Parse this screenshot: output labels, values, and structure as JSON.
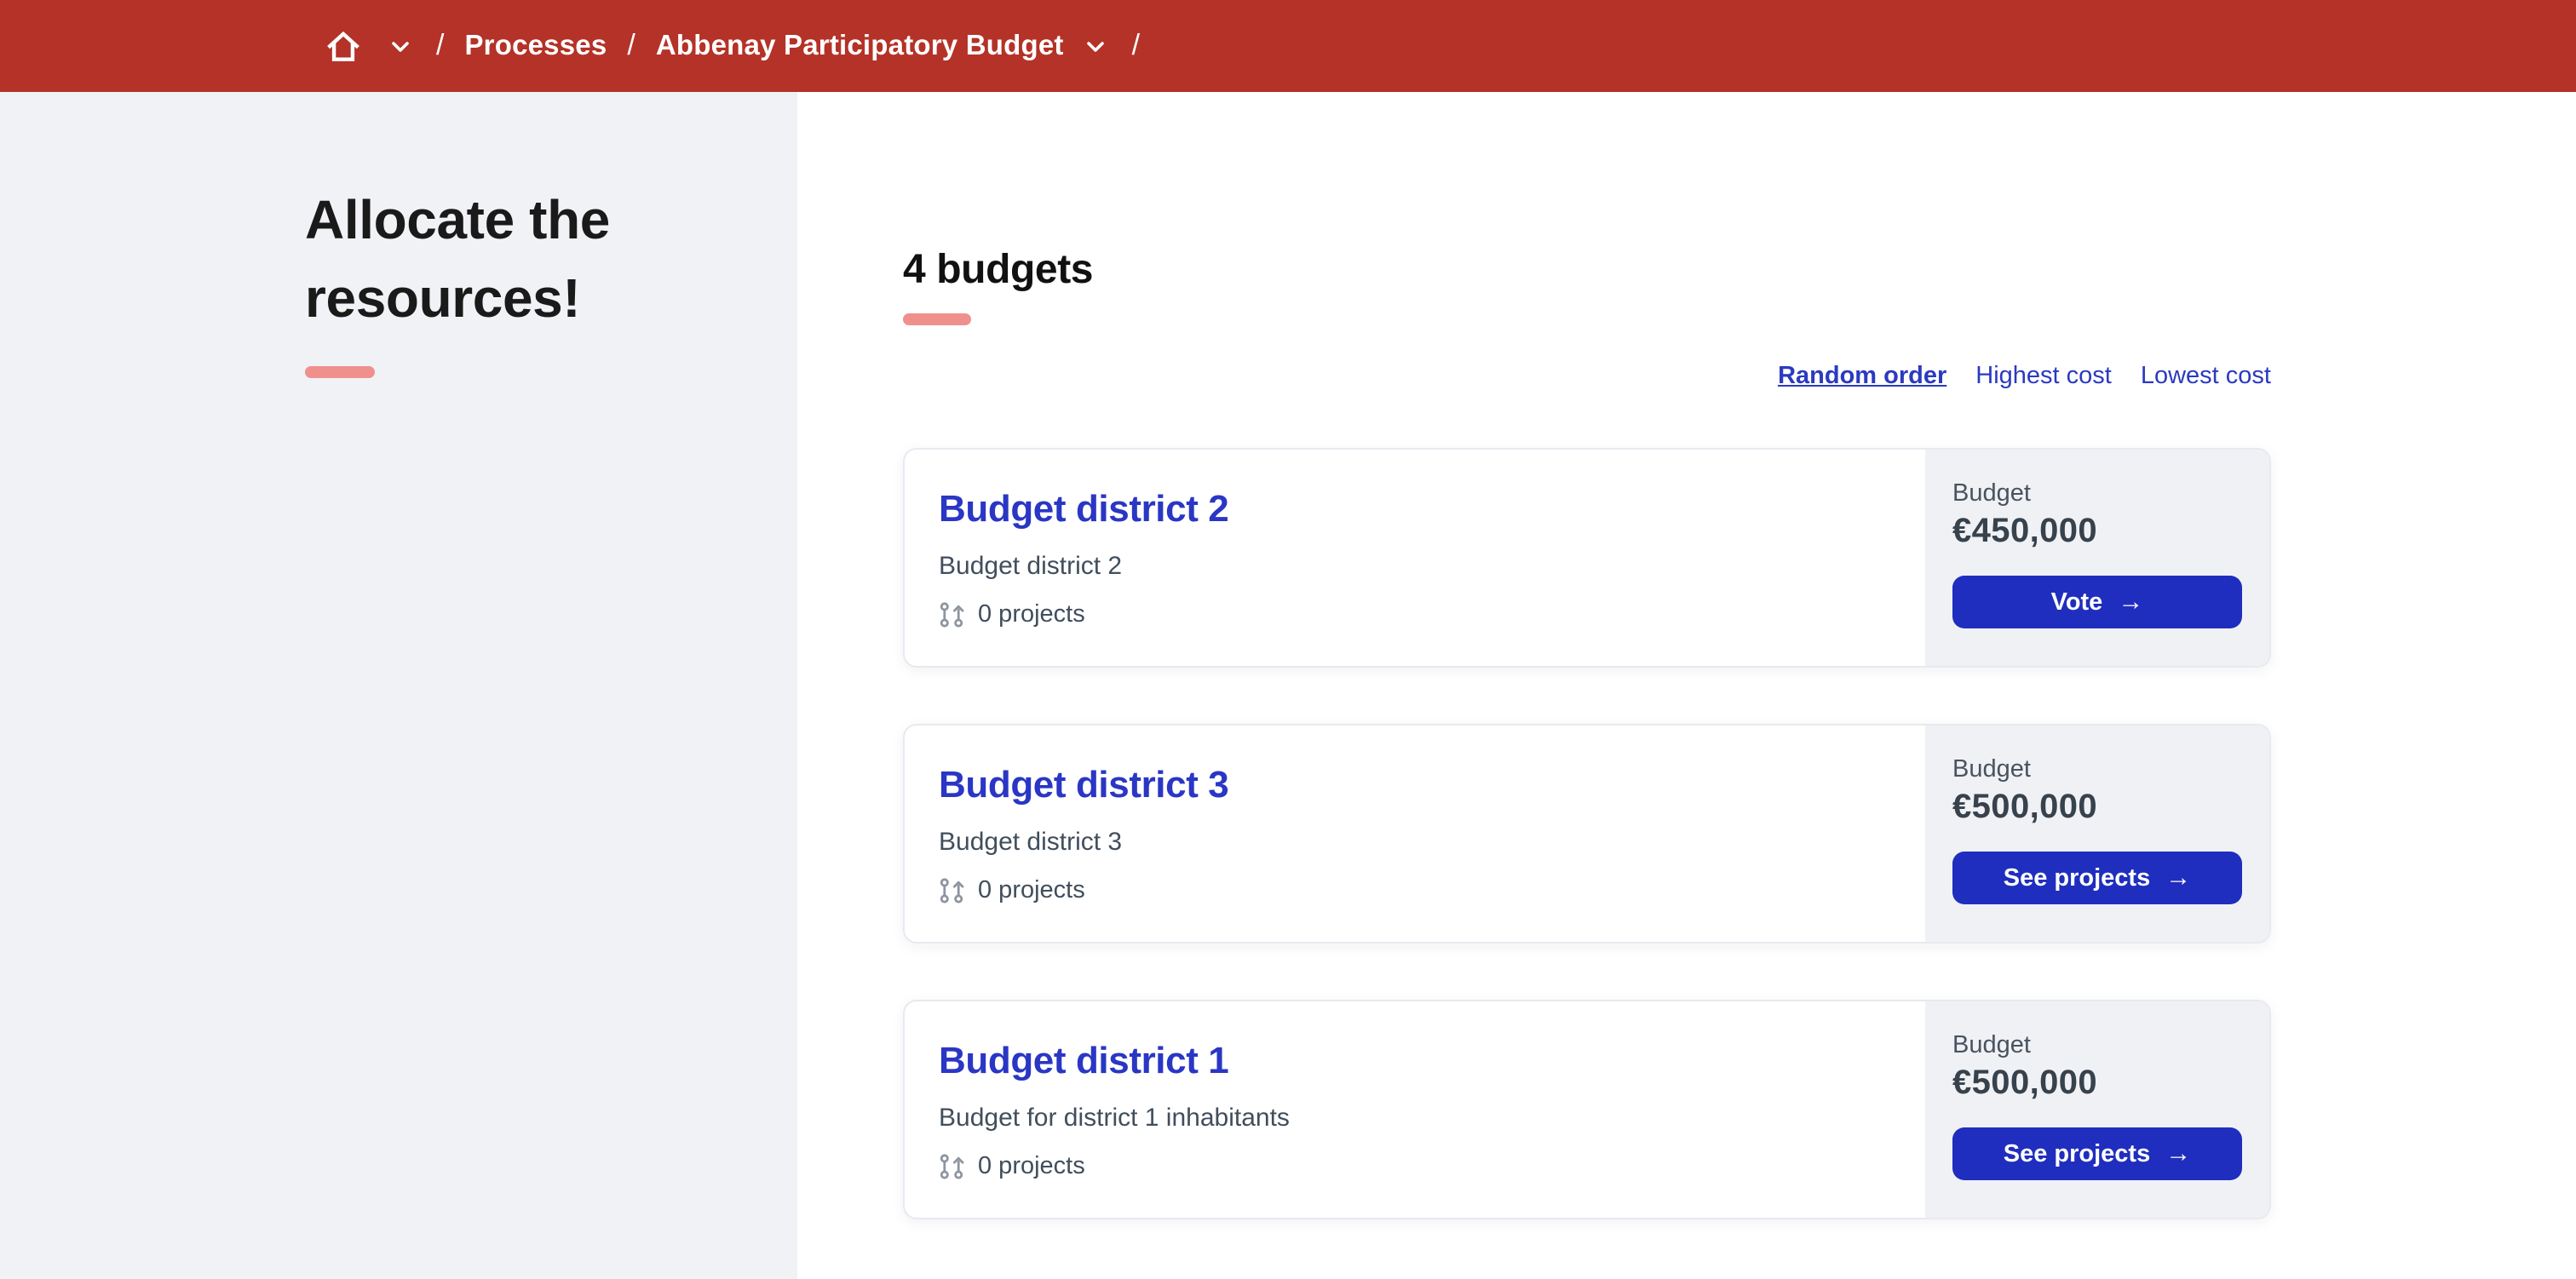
{
  "breadcrumb": {
    "separator": "/",
    "processes_label": "Processes",
    "process_title": "Abbenay Participatory Budget"
  },
  "sidebar": {
    "heading": "Allocate the resources!"
  },
  "main": {
    "heading": "4 budgets",
    "sort": [
      {
        "label": "Random order",
        "active": true
      },
      {
        "label": "Highest cost",
        "active": false
      },
      {
        "label": "Lowest cost",
        "active": false
      }
    ],
    "budget_label": "Budget",
    "cards": [
      {
        "title": "Budget district 2",
        "description": "Budget district 2",
        "projects": "0 projects",
        "amount": "€450,000",
        "action": "Vote"
      },
      {
        "title": "Budget district 3",
        "description": "Budget district 3",
        "projects": "0 projects",
        "amount": "€500,000",
        "action": "See projects"
      },
      {
        "title": "Budget district 1",
        "description": "Budget for district 1 inhabitants",
        "projects": "0 projects",
        "amount": "€500,000",
        "action": "See projects"
      }
    ]
  },
  "icons": {
    "arrow_right": "→"
  },
  "colors": {
    "topbar_red": "#b43227",
    "accent_salmon": "#f0908c",
    "link_blue": "#2b3ac0",
    "title_blue": "#2a36c4",
    "button_blue": "#1f2ebe",
    "sidebar_gray": "#f1f2f6",
    "panel_gray": "#f0f1f5",
    "text_slate": "#414e5c"
  }
}
